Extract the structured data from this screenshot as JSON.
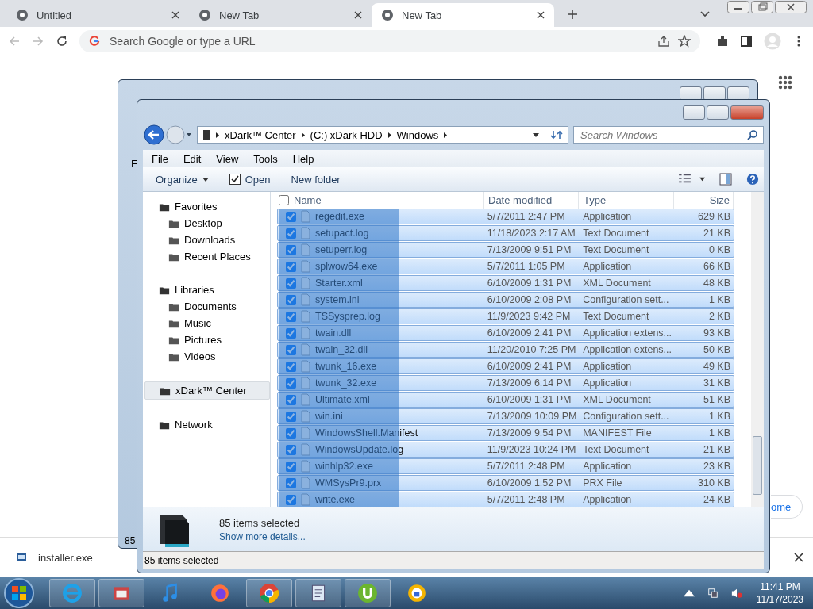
{
  "browser": {
    "tabs": [
      {
        "title": "Untitled",
        "selected": false
      },
      {
        "title": "New Tab",
        "selected": false
      },
      {
        "title": "New Tab",
        "selected": true
      }
    ],
    "address": {
      "placeholder": "Search Google or type a URL"
    },
    "customize_button": "ome",
    "download": {
      "file": "installer.exe"
    }
  },
  "back_window": {
    "menu_text": "F",
    "status_text": "85"
  },
  "explorer": {
    "breadcrumb": [
      "xDark™ Center",
      "(C:) xDark HDD",
      "Windows"
    ],
    "search": {
      "placeholder": "Search Windows"
    },
    "menu": [
      "File",
      "Edit",
      "View",
      "Tools",
      "Help"
    ],
    "commands": {
      "organize": "Organize",
      "open": "Open",
      "new_folder": "New folder"
    },
    "nav": [
      {
        "label": "Favorites",
        "selected": false,
        "children": [
          {
            "label": "Desktop",
            "selected": false
          },
          {
            "label": "Downloads",
            "selected": false
          },
          {
            "label": "Recent Places",
            "selected": false
          }
        ]
      },
      {
        "label": "Libraries",
        "selected": false,
        "children": [
          {
            "label": "Documents",
            "selected": false
          },
          {
            "label": "Music",
            "selected": false
          },
          {
            "label": "Pictures",
            "selected": false
          },
          {
            "label": "Videos",
            "selected": false
          }
        ]
      },
      {
        "label": "xDark™ Center",
        "selected": true
      },
      {
        "label": "Network",
        "selected": false
      }
    ],
    "columns": [
      "Name",
      "Date modified",
      "Type",
      "Size"
    ],
    "select_all": {
      "checked": false
    },
    "rows": [
      {
        "name": "regedit.exe",
        "date": "5/7/2011 2:47 PM",
        "type": "Application",
        "size": "629 KB",
        "selected": true
      },
      {
        "name": "setupact.log",
        "date": "11/18/2023 2:17 AM",
        "type": "Text Document",
        "size": "21 KB",
        "selected": true
      },
      {
        "name": "setuperr.log",
        "date": "7/13/2009 9:51 PM",
        "type": "Text Document",
        "size": "0 KB",
        "selected": true
      },
      {
        "name": "splwow64.exe",
        "date": "5/7/2011 1:05 PM",
        "type": "Application",
        "size": "66 KB",
        "selected": true
      },
      {
        "name": "Starter.xml",
        "date": "6/10/2009 1:31 PM",
        "type": "XML Document",
        "size": "48 KB",
        "selected": true
      },
      {
        "name": "system.ini",
        "date": "6/10/2009 2:08 PM",
        "type": "Configuration sett...",
        "size": "1 KB",
        "selected": true
      },
      {
        "name": "TSSysprep.log",
        "date": "11/9/2023 9:42 PM",
        "type": "Text Document",
        "size": "2 KB",
        "selected": true
      },
      {
        "name": "twain.dll",
        "date": "6/10/2009 2:41 PM",
        "type": "Application extens...",
        "size": "93 KB",
        "selected": true
      },
      {
        "name": "twain_32.dll",
        "date": "11/20/2010 7:25 PM",
        "type": "Application extens...",
        "size": "50 KB",
        "selected": true
      },
      {
        "name": "twunk_16.exe",
        "date": "6/10/2009 2:41 PM",
        "type": "Application",
        "size": "49 KB",
        "selected": true
      },
      {
        "name": "twunk_32.exe",
        "date": "7/13/2009 6:14 PM",
        "type": "Application",
        "size": "31 KB",
        "selected": true
      },
      {
        "name": "Ultimate.xml",
        "date": "6/10/2009 1:31 PM",
        "type": "XML Document",
        "size": "51 KB",
        "selected": true
      },
      {
        "name": "win.ini",
        "date": "7/13/2009 10:09 PM",
        "type": "Configuration sett...",
        "size": "1 KB",
        "selected": true
      },
      {
        "name": "WindowsShell.Manifest",
        "date": "7/13/2009 9:54 PM",
        "type": "MANIFEST File",
        "size": "1 KB",
        "selected": true
      },
      {
        "name": "WindowsUpdate.log",
        "date": "11/9/2023 10:24 PM",
        "type": "Text Document",
        "size": "21 KB",
        "selected": true
      },
      {
        "name": "winhlp32.exe",
        "date": "5/7/2011 2:48 PM",
        "type": "Application",
        "size": "23 KB",
        "selected": true
      },
      {
        "name": "WMSysPr9.prx",
        "date": "6/10/2009 1:52 PM",
        "type": "PRX File",
        "size": "310 KB",
        "selected": true
      },
      {
        "name": "write.exe",
        "date": "5/7/2011 2:48 PM",
        "type": "Application",
        "size": "24 KB",
        "selected": true
      }
    ],
    "details": {
      "count": "85 items selected",
      "link": "Show more details..."
    },
    "status": "85 items selected"
  },
  "taskbar": {
    "time": "11:41 PM",
    "date": "11/17/2023"
  }
}
